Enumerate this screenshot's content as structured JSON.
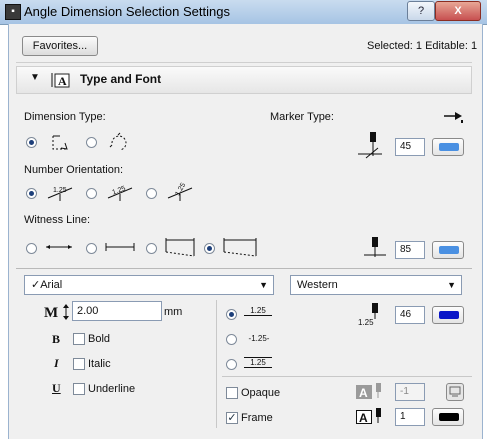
{
  "window": {
    "title": "Angle Dimension Selection Settings",
    "help_label": "?",
    "close_label": "X"
  },
  "toolbar": {
    "favorites_label": "Favorites...",
    "selection_info": "Selected: 1 Editable: 1"
  },
  "panel": {
    "title": "Type and Font",
    "dimension_type_label": "Dimension Type:",
    "marker_type_label": "Marker Type:",
    "marker_size": "45",
    "number_orientation_label": "Number Orientation:",
    "witness_line_label": "Witness Line:",
    "witness_pen": "85",
    "dimension_type_selected": 0,
    "number_orientation_selected": 0,
    "witness_line_selected": 3
  },
  "font": {
    "family": "✓Arial",
    "script": "Western",
    "size": "2.00",
    "size_unit": "mm",
    "bold_label": "Bold",
    "italic_label": "Italic",
    "underline_label": "Underline",
    "bold": false,
    "italic": false,
    "underline": false,
    "format_options": [
      "1.25",
      "-1.25-",
      "1.25"
    ],
    "format_selected": 0,
    "text_sample": "1.25",
    "text_pen": "46",
    "opaque_label": "Opaque",
    "opaque": false,
    "opaque_pen": "-1",
    "frame_label": "Frame",
    "frame": true,
    "frame_pen": "1"
  },
  "colors": {
    "marker_swatch": "#4a90e2",
    "witness_swatch": "#4a90e2",
    "text_swatch": "#0a16c8",
    "frame_swatch": "#000000"
  }
}
